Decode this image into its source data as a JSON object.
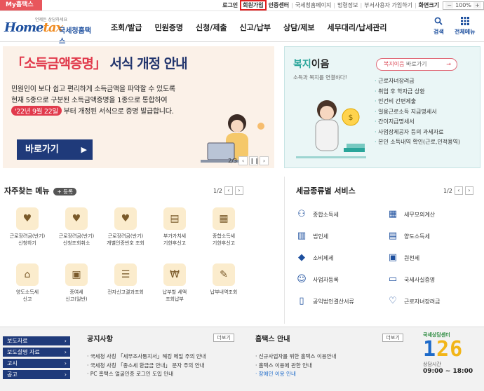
{
  "topbar": {
    "mytax": "My홈택스",
    "links": [
      "로그인",
      "회원가입",
      "인증센터",
      "국세청홈페이지",
      "법령정보",
      "부서사용자 가입하기",
      "화면크기"
    ],
    "zoom": "100%",
    "zoom_minus": "−",
    "zoom_plus": "+"
  },
  "header": {
    "logo_small": "언제든 상담하세요",
    "logo_home": "Home",
    "logo_tax": "tax",
    "logo_nts": "국세청홈택스",
    "nav": [
      "조회/발급",
      "민원증명",
      "신청/제출",
      "신고/납부",
      "상담/제보",
      "세무대리/납세관리"
    ],
    "search_label": "검색",
    "allmenu_label": "전체메뉴"
  },
  "banner": {
    "title_open": "「",
    "title_highlight": "소득금액증명",
    "title_close": "」",
    "title_rest": " 서식 개정 안내",
    "line1": "민원인이 보다 쉽고 편리하게 소득금액을 파악할 수 있도록",
    "line2": "현재 5종으로 구분된 소득금액증명을 1종으로 통합하여",
    "line3_pill": "'22년 9월 22일",
    "line3_rest": " 부터 개정된 서식으로 증명 발급합니다.",
    "button": "바로가기",
    "page": "2/3"
  },
  "welfare": {
    "title_a": "복지",
    "title_b": "이음",
    "subtitle": "소득과 복지를 연결하다!",
    "button": "복지이음",
    "button_suffix": " 바로가기",
    "items": [
      "근로자녀장려금",
      "취업 후 학자금 상환",
      "인건비 간편제출",
      "일용근로소득 지급명세서",
      "간이지급명세서",
      "사업장제공자 등의 과세자료",
      "본인 소득내역 확인(근로,인적용역)"
    ]
  },
  "freq": {
    "title": "자주찾는 메뉴",
    "register": "+ 등록",
    "page": "1/2",
    "items": [
      {
        "label1": "근로장려금(반기)",
        "label2": "신청하기"
      },
      {
        "label1": "근로장려금(반기)",
        "label2": "신청조회취소"
      },
      {
        "label1": "근로장려금(반기)",
        "label2": "개별인증번호 조회"
      },
      {
        "label1": "부가가치세",
        "label2": "기한후신고"
      },
      {
        "label1": "종합소득세",
        "label2": "기한후신고"
      },
      {
        "label1": "양도소득세",
        "label2": "신고"
      },
      {
        "label1": "증여세",
        "label2": "신고(일반)"
      },
      {
        "label1": "전자신고결과조회",
        "label2": ""
      },
      {
        "label1": "납부할 세액",
        "label2": "조회납부"
      },
      {
        "label1": "납부내역조회",
        "label2": ""
      }
    ]
  },
  "taxsvc": {
    "title": "세금종류별 서비스",
    "page": "1/2",
    "items": [
      "종합소득세",
      "세무모의계산",
      "법인세",
      "양도소득세",
      "소비제세",
      "원천세",
      "사업자등록",
      "국세사실증명",
      "공익법인결산서류",
      "근로자녀장려금"
    ]
  },
  "footer": {
    "quick": [
      "보도자료",
      "보도설명 자료",
      "고시",
      "공고"
    ],
    "notice_title": "공지사항",
    "notice_more": "더보기",
    "notices": [
      "국세청 사칭 「세무조사통지서」해킹 메일 주의 안내",
      "국세청 사칭 「종소세 환급금 안내」 문자 주의 안내",
      "PC 홈택스 얼굴인증 로그인 도입 안내"
    ],
    "hometax_title": "홈택스 안내",
    "hometax_more": "더보기",
    "hometax_items": [
      "신규사업자를 위한 홈택스 이용안내",
      "홈택스 이용에 관한 안내",
      "장애인 이용 안내"
    ],
    "cc_tag": "국세상담센터",
    "cc_num_a": "1",
    "cc_num_b": "26",
    "cc_hours_label": "상담시간",
    "cc_hours": "09:00 ~ 18:00"
  },
  "colors": {
    "brand_blue": "#1d4f9e",
    "navy_button": "#1f3a7a",
    "accent_red": "#e13a4c",
    "teal": "#2aa59a"
  }
}
